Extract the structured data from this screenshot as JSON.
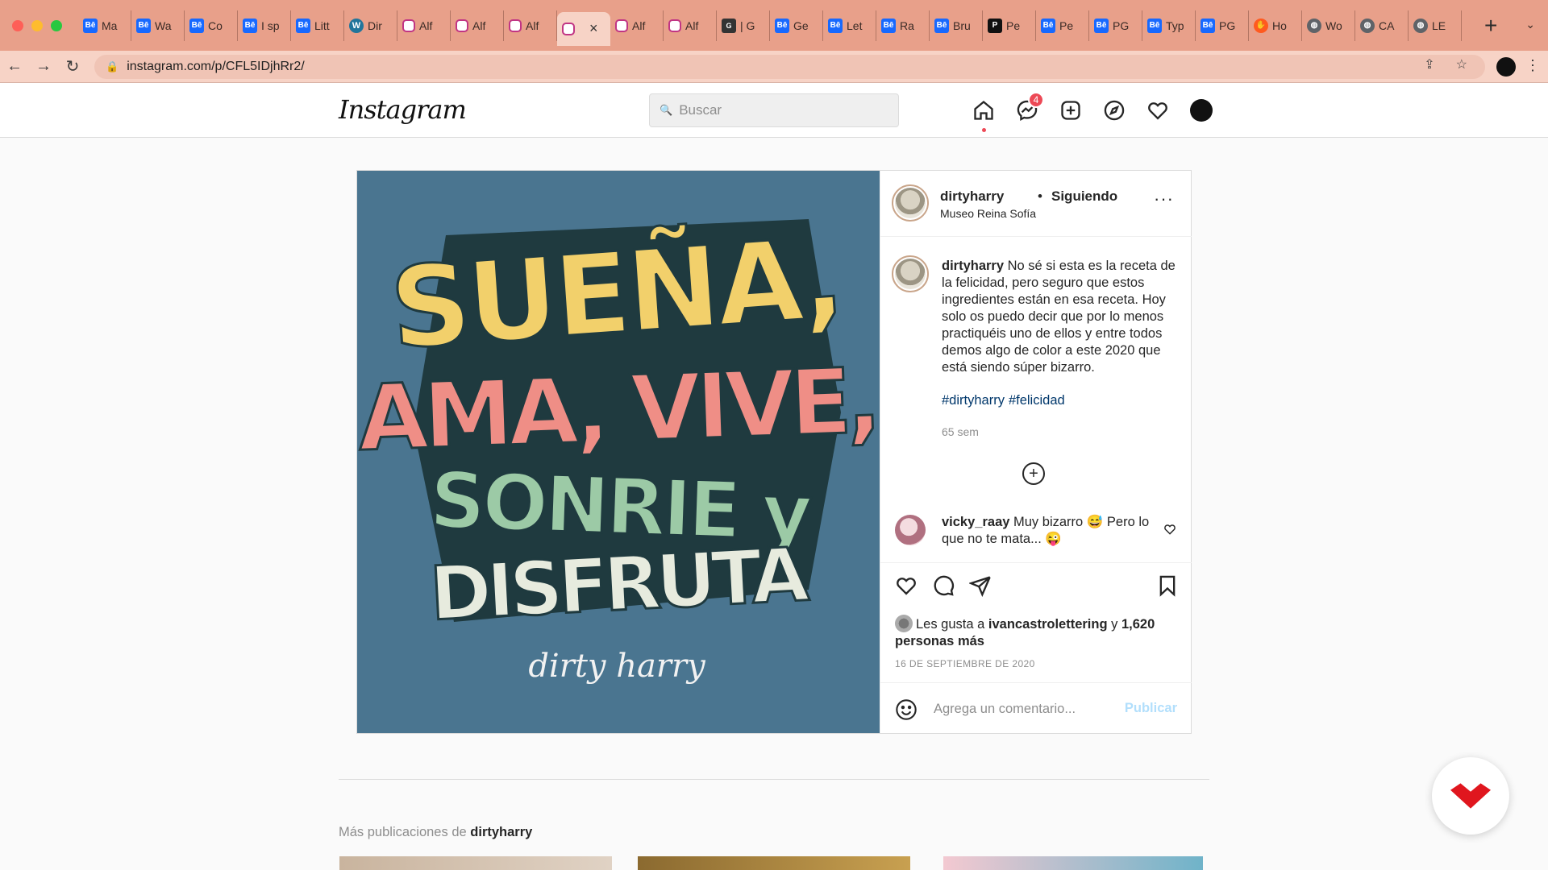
{
  "browser": {
    "tabs": [
      {
        "label": "Ma",
        "icon": "behance-icon"
      },
      {
        "label": "Wa",
        "icon": "behance-icon"
      },
      {
        "label": "Co",
        "icon": "behance-icon"
      },
      {
        "label": "I sp",
        "icon": "behance-icon"
      },
      {
        "label": "Litt",
        "icon": "behance-icon"
      },
      {
        "label": "Dir",
        "icon": "wordpress-icon"
      },
      {
        "label": "Alf",
        "icon": "instagram-icon"
      },
      {
        "label": "Alf",
        "icon": "instagram-icon"
      },
      {
        "label": "Alf",
        "icon": "instagram-icon"
      },
      {
        "label": "",
        "icon": "instagram-icon",
        "active": true
      },
      {
        "label": "Alf",
        "icon": "instagram-icon"
      },
      {
        "label": "Alf",
        "icon": "instagram-icon"
      },
      {
        "label": "| G",
        "icon": "lettering-icon"
      },
      {
        "label": "Ge",
        "icon": "behance-icon"
      },
      {
        "label": "Let",
        "icon": "behance-icon"
      },
      {
        "label": "Ra",
        "icon": "behance-icon"
      },
      {
        "label": "Bru",
        "icon": "behance-icon"
      },
      {
        "label": "Pe",
        "icon": "pinterest-icon"
      },
      {
        "label": "Pe",
        "icon": "behance-icon"
      },
      {
        "label": "PG",
        "icon": "behance-icon"
      },
      {
        "label": "Typ",
        "icon": "behance-icon"
      },
      {
        "label": "PG",
        "icon": "behance-icon"
      },
      {
        "label": "Ho",
        "icon": "hand-icon"
      },
      {
        "label": "Wo",
        "icon": "globe-icon"
      },
      {
        "label": "CA",
        "icon": "globe-icon"
      },
      {
        "label": "LE",
        "icon": "globe-icon"
      }
    ],
    "favicon_text": {
      "behance": "Bē",
      "wordpress": "W",
      "pinterest": "P",
      "lettering": "G",
      "hand": "✋",
      "globe": "◍"
    },
    "url": "instagram.com/p/CFL5IDjhRr2/",
    "new_tab": "+",
    "tab_close": "×"
  },
  "header": {
    "logo": "Instagram",
    "search_placeholder": "Buscar",
    "messages_badge": "4"
  },
  "post": {
    "artwork_text": {
      "line1": "SUEÑA,",
      "line2": "AMA, VIVE,",
      "line3": "SONRIE y",
      "line4": "DISFRUTA",
      "signature": "dirty harry"
    },
    "author": "dirtyharry",
    "dot": "•",
    "follow_status": "Siguiendo",
    "location": "Museo Reina Sofía",
    "more": "···",
    "caption": "No sé si esta es la receta de la felicidad, pero seguro que estos ingredientes están en esa receta. Hoy solo os puedo decir que por lo menos practiquéis uno de ellos y entre todos demos algo de color a este 2020 que está siendo súper bizarro.",
    "hashtags": [
      "#dirtyharry",
      "#felicidad"
    ],
    "time": "65 sem",
    "load_more": "+",
    "comment": {
      "user": "vicky_raay",
      "text": "Muy bizarro 😅 Pero lo que no te mata... 😜"
    },
    "likes": {
      "prefix": "Les gusta a",
      "liker": "ivancastrolettering",
      "conj": "y",
      "others": "1,620 personas más"
    },
    "date": "16 DE SEPTIEMBRE DE 2020",
    "comment_placeholder": "Agrega un comentario...",
    "publish": "Publicar"
  },
  "more": {
    "prefix": "Más publicaciones de",
    "user": "dirtyharry"
  },
  "colors": {
    "artwork_bg": "#4a7590",
    "yellow": "#f2d06b",
    "pink": "#ef8e86",
    "orange": "#f0a64e",
    "green": "#9ccaa6",
    "cream": "#e7ebde",
    "dark": "#1f3a3f",
    "badge": "#ed4956",
    "link": "#00376b"
  }
}
